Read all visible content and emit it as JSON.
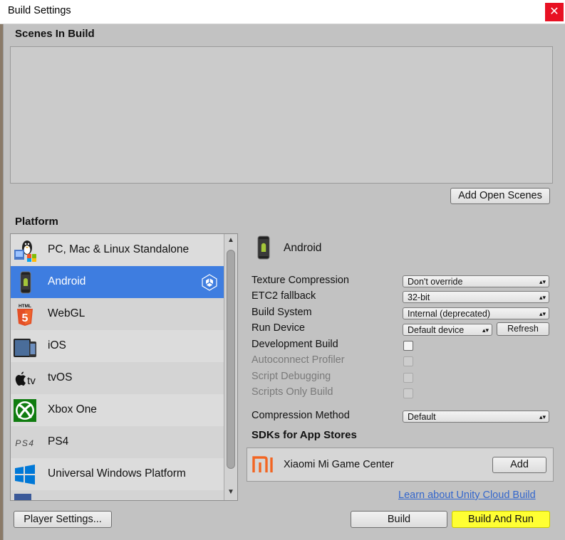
{
  "window": {
    "title": "Build Settings",
    "close_symbol": "✕"
  },
  "scenes": {
    "header": "Scenes In Build",
    "add_open_scenes_label": "Add Open Scenes"
  },
  "platform": {
    "header": "Platform",
    "items": [
      {
        "label": "PC, Mac & Linux Standalone",
        "icon": "pc-mac-linux-icon"
      },
      {
        "label": "Android",
        "icon": "android-icon",
        "selected": true
      },
      {
        "label": "WebGL",
        "icon": "html5-icon"
      },
      {
        "label": "iOS",
        "icon": "ios-devices-icon"
      },
      {
        "label": "tvOS",
        "icon": "apple-tv-icon",
        "icon_text": "tv"
      },
      {
        "label": "Xbox One",
        "icon": "xbox-icon"
      },
      {
        "label": "PS4",
        "icon": "ps4-icon",
        "icon_text": "PS4"
      },
      {
        "label": "Universal Windows Platform",
        "icon": "windows-icon"
      }
    ]
  },
  "selected_platform": {
    "name": "Android"
  },
  "settings": {
    "texture_compression": {
      "label": "Texture Compression",
      "value": "Don't override"
    },
    "etc2_fallback": {
      "label": "ETC2 fallback",
      "value": "32-bit"
    },
    "build_system": {
      "label": "Build System",
      "value": "Internal (deprecated)"
    },
    "run_device": {
      "label": "Run Device",
      "value": "Default device",
      "refresh_label": "Refresh"
    },
    "development_build": {
      "label": "Development Build",
      "checked": false
    },
    "autoconnect_profiler": {
      "label": "Autoconnect Profiler",
      "checked": false,
      "disabled": true
    },
    "script_debugging": {
      "label": "Script Debugging",
      "checked": false,
      "disabled": true
    },
    "scripts_only_build": {
      "label": "Scripts Only Build",
      "checked": false,
      "disabled": true
    },
    "compression_method": {
      "label": "Compression Method",
      "value": "Default"
    }
  },
  "sdks": {
    "header": "SDKs for App Stores",
    "items": [
      {
        "name": "Xiaomi Mi Game Center",
        "icon": "xiaomi-mi-icon",
        "add_label": "Add"
      }
    ]
  },
  "learn_link": "Learn about Unity Cloud Build",
  "footer": {
    "player_settings_label": "Player Settings...",
    "build_label": "Build",
    "build_and_run_label": "Build And Run"
  },
  "colors": {
    "selection": "#3e7de0",
    "highlight": "#ffff33",
    "panel": "#c2c2c2",
    "link": "#3366cc",
    "xiaomi": "#f26522",
    "xbox": "#107c10",
    "html5": "#e34f26",
    "windows": "#0078d7"
  }
}
